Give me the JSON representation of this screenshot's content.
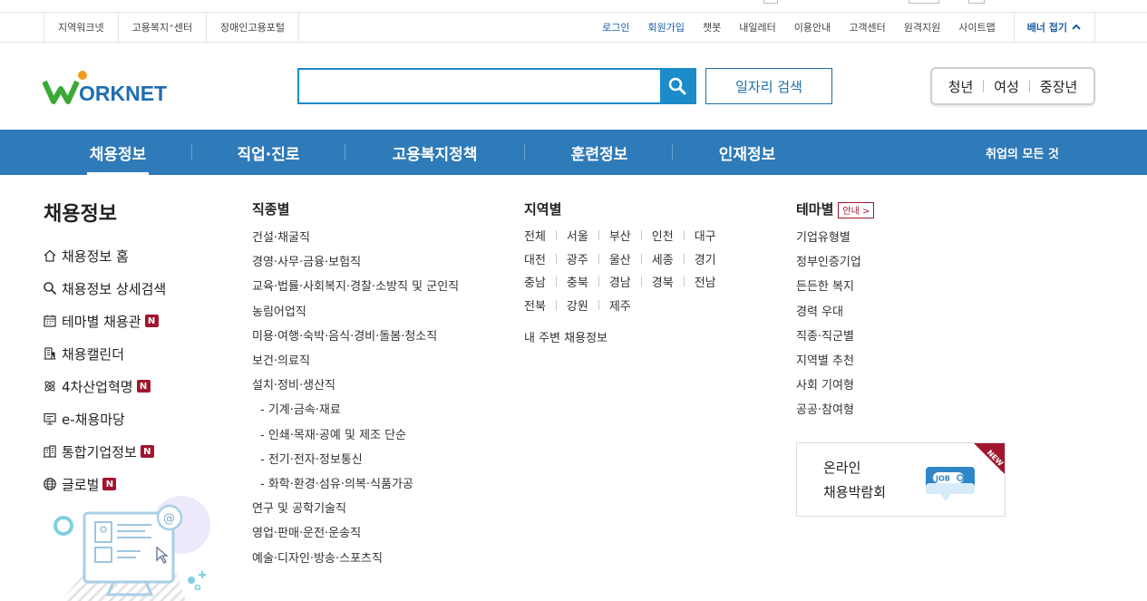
{
  "util_bar": {
    "left_links": [
      "지역워크넷",
      "고용복지⁺센터",
      "장애인고용포털"
    ],
    "right_links": [
      {
        "label": "로그인",
        "highlight": true
      },
      {
        "label": "회원가입",
        "highlight": true
      },
      {
        "label": "챗봇",
        "highlight": false
      },
      {
        "label": "내일레터",
        "highlight": false
      },
      {
        "label": "이용안내",
        "highlight": false
      },
      {
        "label": "고객센터",
        "highlight": false
      },
      {
        "label": "원격지원",
        "highlight": false
      },
      {
        "label": "사이트맵",
        "highlight": false
      }
    ],
    "banner_toggle": "배너 접기"
  },
  "header": {
    "logo_text": "WORKNET",
    "search_value": "",
    "job_search_button": "일자리 검색",
    "target_groups": [
      "청년",
      "여성",
      "중장년"
    ]
  },
  "gnb": {
    "items": [
      "채용정보",
      "직업·진로",
      "고용복지정책",
      "훈련정보",
      "인재정보"
    ],
    "active_index": 0,
    "extra": "취업의 모든 것"
  },
  "left_panel": {
    "title": "채용정보",
    "menu": [
      {
        "label": "채용정보 홈",
        "icon": "home-icon",
        "new": false
      },
      {
        "label": "채용정보 상세검색",
        "icon": "search-icon",
        "new": false
      },
      {
        "label": "테마별 채용관",
        "icon": "calendar-icon",
        "new": true
      },
      {
        "label": "채용캘린더",
        "icon": "building-icon",
        "new": false
      },
      {
        "label": "4차산업혁명",
        "icon": "atom-icon",
        "new": true
      },
      {
        "label": "e-채용마당",
        "icon": "monitor-icon",
        "new": false
      },
      {
        "label": "통합기업정보",
        "icon": "company-icon",
        "new": true
      },
      {
        "label": "글로벌",
        "icon": "globe-icon",
        "new": true
      }
    ],
    "new_badge": "N"
  },
  "job_types": {
    "title": "직종별",
    "items": [
      {
        "label": "건설·채굴직",
        "sub": false
      },
      {
        "label": "경영·사무·금융·보험직",
        "sub": false
      },
      {
        "label": "교육·법률·사회복지·경찰·소방직 및 군인직",
        "sub": false
      },
      {
        "label": "농림어업직",
        "sub": false
      },
      {
        "label": "미용·여행·숙박·음식·경비·돌봄·청소직",
        "sub": false
      },
      {
        "label": "보건·의료직",
        "sub": false
      },
      {
        "label": "설치·정비·생산직",
        "sub": false
      },
      {
        "label": "- 기계·금속·재료",
        "sub": true
      },
      {
        "label": "- 인쇄·목재·공예 및 제조 단순",
        "sub": true
      },
      {
        "label": "- 전기·전자·정보통신",
        "sub": true
      },
      {
        "label": "- 화학·환경·섬유·의복·식품가공",
        "sub": true
      },
      {
        "label": "연구 및 공학기술직",
        "sub": false
      },
      {
        "label": "영업·판매·운전·운송직",
        "sub": false
      },
      {
        "label": "예술·디자인·방송·스포츠직",
        "sub": false
      }
    ]
  },
  "regions": {
    "title": "지역별",
    "rows": [
      [
        "전체",
        "서울",
        "부산",
        "인천",
        "대구"
      ],
      [
        "대전",
        "광주",
        "울산",
        "세종",
        "경기"
      ],
      [
        "충남",
        "충북",
        "경남",
        "경북",
        "전남"
      ],
      [
        "전북",
        "강원",
        "제주"
      ]
    ],
    "nearby": "내 주변 채용정보"
  },
  "themes": {
    "title": "테마별",
    "guide_badge": "안내 >",
    "items": [
      "기업유형별",
      "정부인증기업",
      "든든한 복지",
      "경력 우대",
      "직종·직군별",
      "지역별 추천",
      "사회 기여형",
      "공공·참여형"
    ]
  },
  "expo_banner": {
    "line1": "온라인",
    "line2": "채용박람회",
    "ribbon": "NEW",
    "icon_text": "JOB"
  },
  "colors": {
    "brand_blue": "#2f7ab9",
    "search_blue": "#1c8bc9",
    "badge_red": "#a1152e",
    "logo_green": "#3aa935"
  }
}
